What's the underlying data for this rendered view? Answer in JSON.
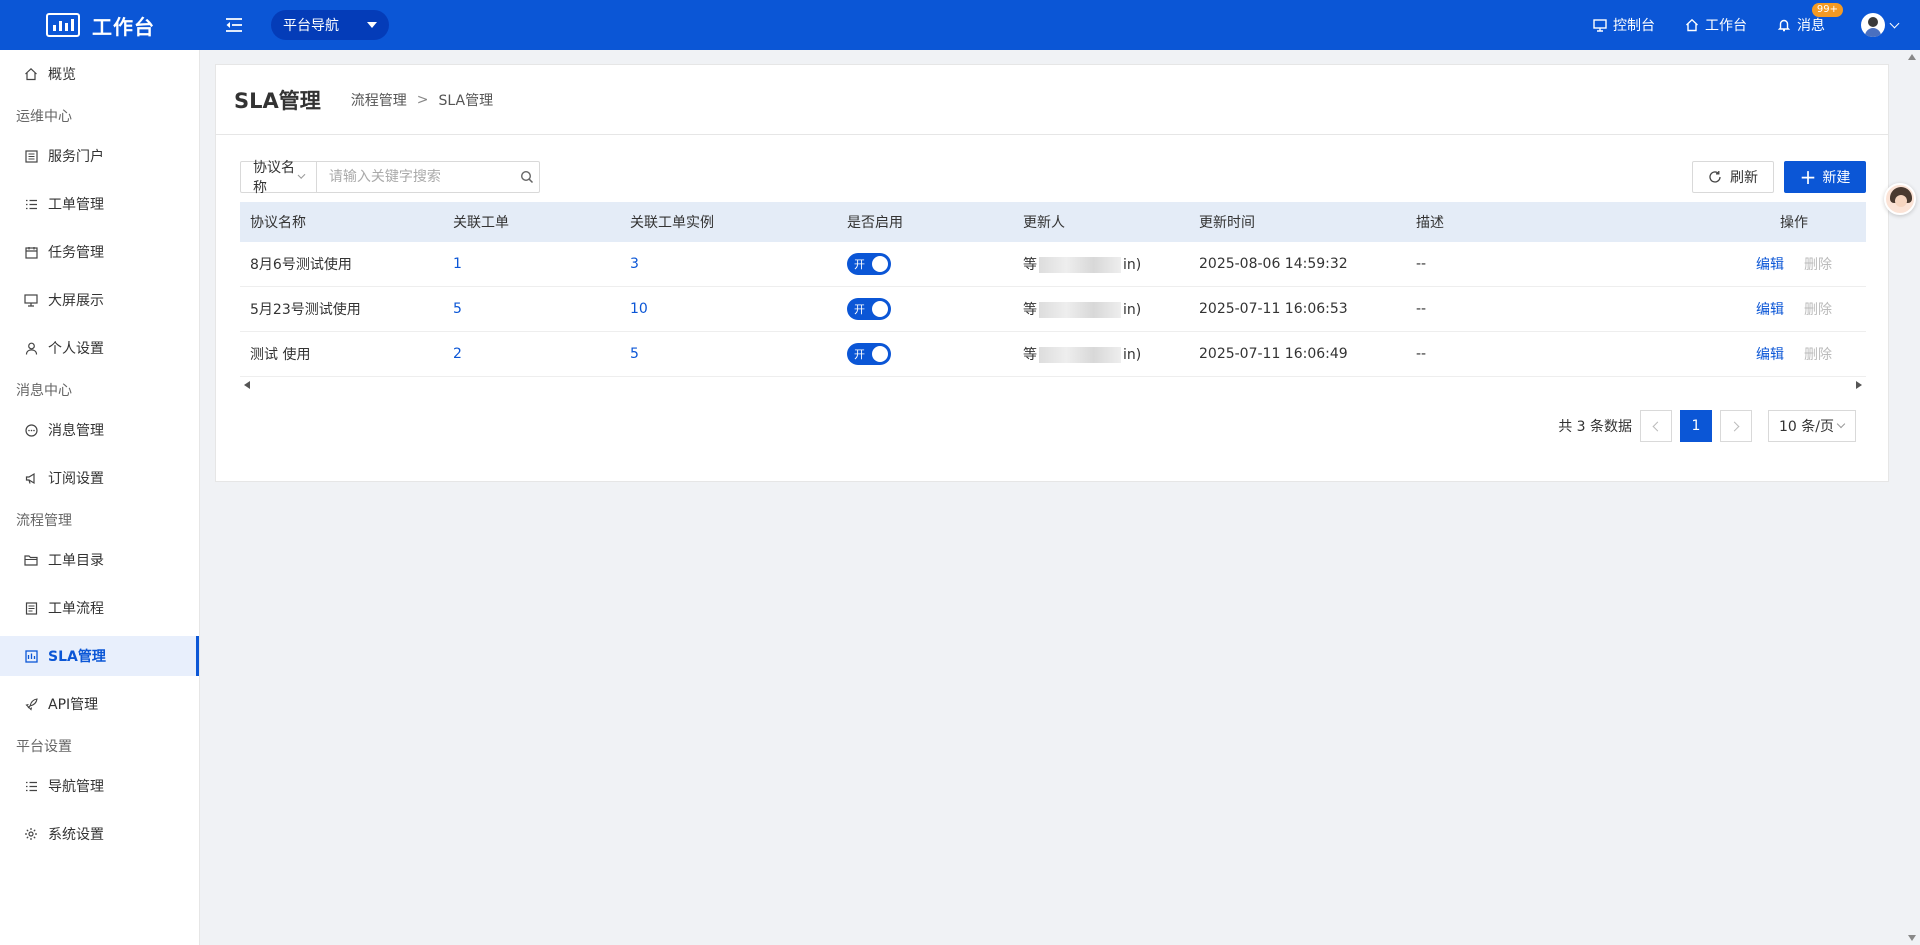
{
  "app": {
    "title": "工作台",
    "nav_select": "平台导航"
  },
  "topbar": {
    "links": [
      {
        "label": "控制台",
        "icon": "monitor-icon"
      },
      {
        "label": "工作台",
        "icon": "home-icon"
      },
      {
        "label": "消息",
        "icon": "bell-icon",
        "badge": "99+"
      }
    ]
  },
  "sidebar": {
    "top_item": {
      "label": "概览",
      "icon": "home-icon"
    },
    "groups": [
      {
        "title": "运维中心",
        "items": [
          {
            "label": "服务门户",
            "icon": "portal-icon"
          },
          {
            "label": "工单管理",
            "icon": "list-icon"
          },
          {
            "label": "任务管理",
            "icon": "calendar-icon"
          },
          {
            "label": "大屏展示",
            "icon": "monitor-icon"
          },
          {
            "label": "个人设置",
            "icon": "user-icon"
          }
        ]
      },
      {
        "title": "消息中心",
        "items": [
          {
            "label": "消息管理",
            "icon": "message-icon"
          },
          {
            "label": "订阅设置",
            "icon": "megaphone-icon"
          }
        ]
      },
      {
        "title": "流程管理",
        "items": [
          {
            "label": "工单目录",
            "icon": "folder-icon"
          },
          {
            "label": "工单流程",
            "icon": "document-icon"
          },
          {
            "label": "SLA管理",
            "icon": "sla-icon",
            "active": true
          },
          {
            "label": "API管理",
            "icon": "rocket-icon"
          }
        ]
      },
      {
        "title": "平台设置",
        "items": [
          {
            "label": "导航管理",
            "icon": "list-icon"
          },
          {
            "label": "系统设置",
            "icon": "gear-icon"
          }
        ]
      }
    ]
  },
  "page": {
    "title": "SLA管理",
    "breadcrumb": [
      "流程管理",
      "SLA管理"
    ],
    "breadcrumb_sep": ">"
  },
  "search": {
    "field": "协议名称",
    "placeholder": "请输入关键字搜索"
  },
  "actions": {
    "refresh": "刷新",
    "new": "新建"
  },
  "table": {
    "headers": [
      "协议名称",
      "关联工单",
      "关联工单实例",
      "是否启用",
      "更新人",
      "更新时间",
      "描述",
      "操作"
    ],
    "rows": [
      {
        "name": "8月6号测试使用",
        "tickets": "1",
        "instances": "3",
        "enabled": "开",
        "updater_pre": "等",
        "updater_post": "in)",
        "time": "2025-08-06 14:59:32",
        "desc": "--",
        "edit": "编辑",
        "delete": "删除"
      },
      {
        "name": "5月23号测试使用",
        "tickets": "5",
        "instances": "10",
        "enabled": "开",
        "updater_pre": "等",
        "updater_post": "in)",
        "time": "2025-07-11 16:06:53",
        "desc": "--",
        "edit": "编辑",
        "delete": "删除"
      },
      {
        "name": "测试 使用",
        "tickets": "2",
        "instances": "5",
        "enabled": "开",
        "updater_pre": "等",
        "updater_post": "in)",
        "time": "2025-07-11 16:06:49",
        "desc": "--",
        "edit": "编辑",
        "delete": "删除"
      }
    ]
  },
  "pagination": {
    "total": "共 3 条数据",
    "current": "1",
    "page_size": "10 条/页"
  },
  "colors": {
    "primary": "#0b56d6",
    "header_bg": "#e4ecf7",
    "badge": "#f59a23"
  }
}
